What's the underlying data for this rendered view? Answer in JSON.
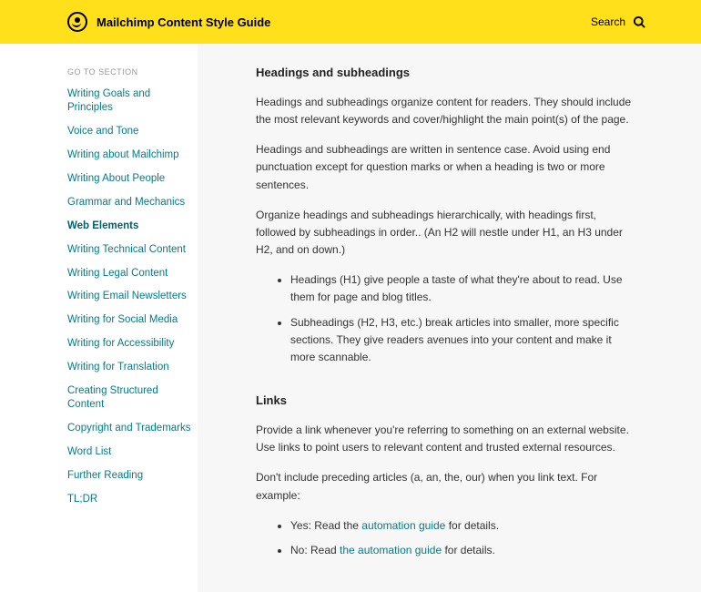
{
  "header": {
    "title": "Mailchimp Content Style Guide",
    "search": "Search"
  },
  "sidebar": {
    "heading": "GO TO SECTION",
    "items": [
      "Writing Goals and Principles",
      "Voice and Tone",
      "Writing about Mailchimp",
      "Writing About People",
      "Grammar and Mechanics",
      "Web Elements",
      "Writing Technical Content",
      "Writing Legal Content",
      "Writing Email Newsletters",
      "Writing for Social Media",
      "Writing for Accessibility",
      "Writing for Translation",
      "Creating Structured Content",
      "Copyright and Trademarks",
      "Word List",
      "Further Reading",
      "TL;DR"
    ],
    "active": 5
  },
  "content": {
    "h1": "Headings and subheadings",
    "p1": "Headings and subheadings organize content for readers. They should include the most relevant keywords and cover/highlight the main point(s) of the page.",
    "p2": "Headings and subheadings are written in sentence case. Avoid using end punctuation except for question marks or when a heading is two or more sentences.",
    "p3": "Organize headings and subheadings hierarchically, with headings first, followed by subheadings in order.. (An H2 will nestle under H1, an H3 under H2, and on down.)",
    "li1": "Headings (H1) give people a taste of what they're about to read. Use them for page and blog titles.",
    "li2": "Subheadings (H2, H3, etc.) break articles into smaller, more specific sections. They give readers avenues into your content and make it more scannable.",
    "h2": "Links",
    "p4": "Provide a link whenever you're referring to something on an external website. Use links to point users to relevant content and trusted external resources.",
    "p5": "Don't include preceding articles (a, an, the, our) when you link text. For example:",
    "ex": {
      "yesPre": "Yes: Read the ",
      "yesLink": "automation guide",
      "yesPost": " for details.",
      "noPre": "No: Read ",
      "noLink": "the automation guide",
      "noPost": " for details."
    }
  }
}
